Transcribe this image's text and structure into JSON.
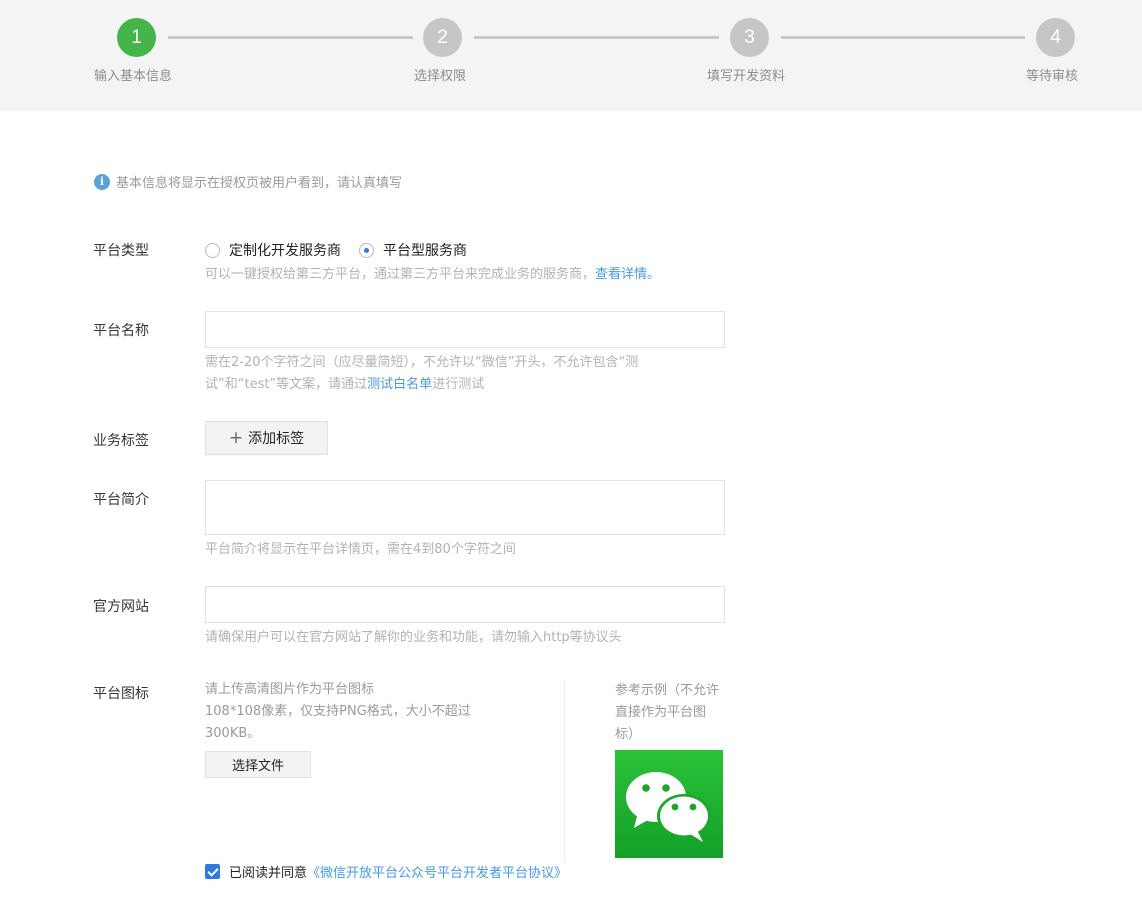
{
  "steps": [
    {
      "number": "1",
      "label": "输入基本信息",
      "active": true
    },
    {
      "number": "2",
      "label": "选择权限",
      "active": false
    },
    {
      "number": "3",
      "label": "填写开发资料",
      "active": false
    },
    {
      "number": "4",
      "label": "等待审核",
      "active": false
    }
  ],
  "notice": {
    "icon": "info-icon",
    "text": "基本信息将显示在授权页被用户看到，请认真填写"
  },
  "platform_type": {
    "label": "平台类型",
    "options": [
      {
        "label": "定制化开发服务商",
        "checked": false
      },
      {
        "label": "平台型服务商",
        "checked": true
      }
    ],
    "hint": "可以一键授权给第三方平台，通过第三方平台来完成业务的服务商，",
    "hint_link": "查看详情。"
  },
  "platform_name": {
    "label": "平台名称",
    "value": "",
    "hint_line1": "需在2-20个字符之间（应尽量简短），不允许以“微信”开头，不允许包含“测",
    "hint_line2_pre": "试”和“test”等文案，请通过",
    "hint_line2_link": "测试白名单",
    "hint_line2_post": "进行测试"
  },
  "business_tags": {
    "label": "业务标签",
    "button": "添加标签",
    "button_icon": "plus-icon"
  },
  "platform_intro": {
    "label": "平台简介",
    "value": "",
    "hint": "平台简介将显示在平台详情页，需在4到80个字符之间"
  },
  "website": {
    "label": "官方网站",
    "value": "",
    "hint": "请确保用户可以在官方网站了解你的业务和功能，请勿输入http等协议头"
  },
  "platform_icon": {
    "label": "平台图标",
    "desc_line1": "请上传高清图片作为平台图标",
    "desc_line2": "108*108像素，仅支持PNG格式，大小不超过",
    "desc_line3": "300KB。",
    "button": "选择文件",
    "sample_text": "参考示例（不允许直接作为平台图标）",
    "sample_icon": "wechat-logo",
    "sample_bg": "#1aad19"
  },
  "agreement": {
    "text": "已阅读并同意",
    "link": "《微信开放平台公众号平台开发者平台协议》",
    "checked": true
  }
}
